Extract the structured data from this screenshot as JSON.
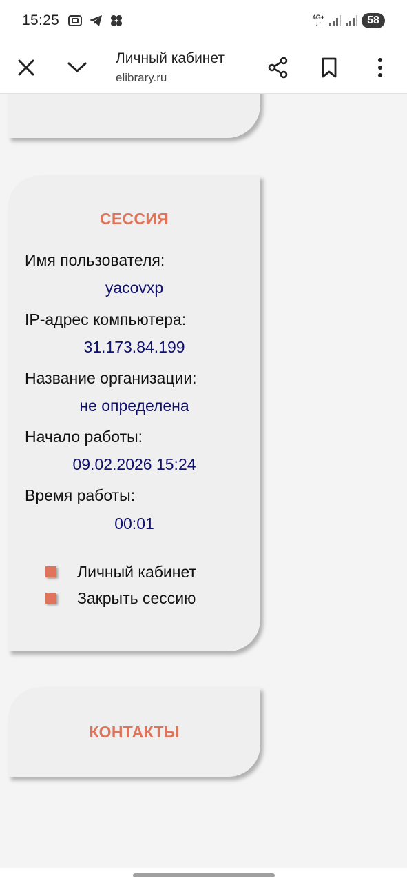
{
  "status": {
    "time": "15:25",
    "network": "4G+",
    "battery": "58"
  },
  "toolbar": {
    "title": "Личный кабинет",
    "url": "elibrary.ru"
  },
  "session": {
    "heading": "СЕССИЯ",
    "username_label": "Имя пользователя:",
    "username_value": "yacovxp",
    "ip_label": "IP-адрес компьютера:",
    "ip_value": "31.173.84.199",
    "org_label": "Название организации:",
    "org_value": "не определена",
    "start_label": "Начало работы:",
    "start_value": "09.02.2026 15:24",
    "duration_label": "Время работы:",
    "duration_value": "00:01",
    "links": [
      "Личный кабинет",
      "Закрыть сессию"
    ]
  },
  "contacts": {
    "heading": "КОНТАКТЫ"
  },
  "colors": {
    "accent": "#e0745a",
    "value_text": "#10106e",
    "card_bg": "#efefef",
    "page_bg": "#f4f4f4"
  }
}
